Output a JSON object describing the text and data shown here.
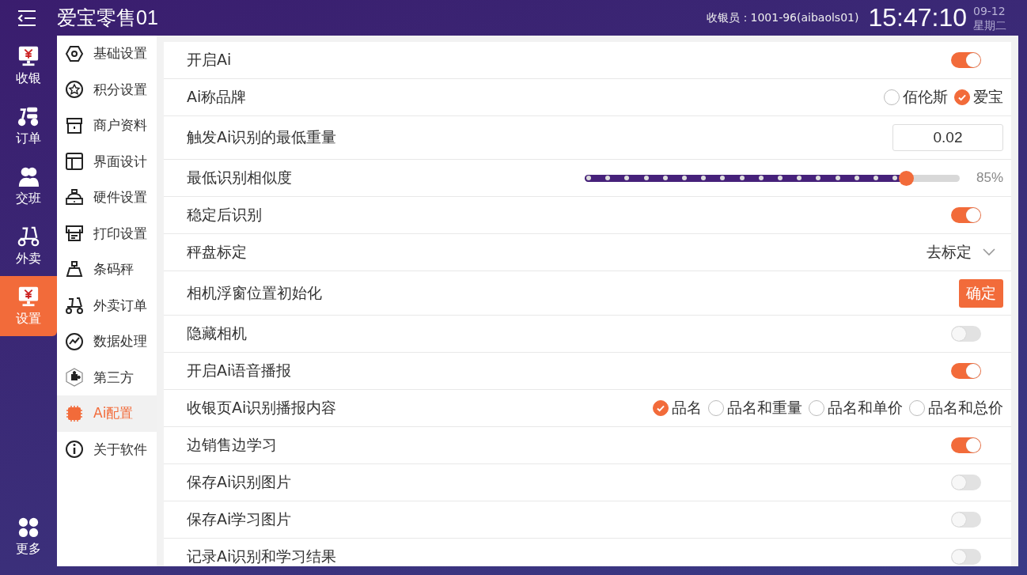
{
  "header": {
    "title": "爱宝零售01",
    "cashier": "收银员：1001-96(aibaols01)",
    "time": "15:47:10",
    "date": "09-12",
    "weekday": "星期二"
  },
  "nav": [
    {
      "label": "收银",
      "selected": false
    },
    {
      "label": "订单",
      "selected": false
    },
    {
      "label": "交班",
      "selected": false
    },
    {
      "label": "外卖",
      "selected": false
    },
    {
      "label": "设置",
      "selected": true
    },
    {
      "label": "更多",
      "selected": false
    }
  ],
  "submenu": [
    {
      "label": "基础设置",
      "selected": false
    },
    {
      "label": "积分设置",
      "selected": false
    },
    {
      "label": "商户资料",
      "selected": false
    },
    {
      "label": "界面设计",
      "selected": false
    },
    {
      "label": "硬件设置",
      "selected": false
    },
    {
      "label": "打印设置",
      "selected": false
    },
    {
      "label": "条码秤",
      "selected": false
    },
    {
      "label": "外卖订单",
      "selected": false
    },
    {
      "label": "数据处理",
      "selected": false
    },
    {
      "label": "第三方",
      "selected": false
    },
    {
      "label": "Ai配置",
      "selected": true
    },
    {
      "label": "关于软件",
      "selected": false
    }
  ],
  "settings": [
    {
      "kind": "toggle",
      "label": "开启Ai",
      "on": true
    },
    {
      "kind": "radio",
      "label": "Ai称品牌",
      "options": [
        {
          "label": "佰伦斯",
          "selected": false
        },
        {
          "label": "爱宝",
          "selected": true
        }
      ]
    },
    {
      "kind": "input",
      "label": "触发Ai识别的最低重量",
      "value": "0.02"
    },
    {
      "kind": "slider",
      "label": "最低识别相似度",
      "level": 0.85,
      "reading": "85%"
    },
    {
      "kind": "toggle",
      "label": "稳定后识别",
      "on": true
    },
    {
      "kind": "dropdown",
      "label": "秤盘标定",
      "value": "去标定"
    },
    {
      "kind": "button",
      "label": "相机浮窗位置初始化",
      "button": "确定"
    },
    {
      "kind": "toggle",
      "label": "隐藏相机",
      "on": false
    },
    {
      "kind": "toggle",
      "label": "开启Ai语音播报",
      "on": true
    },
    {
      "kind": "radio",
      "label": "收银页Ai识别播报内容",
      "options": [
        {
          "label": "品名",
          "selected": true
        },
        {
          "label": "品名和重量",
          "selected": false
        },
        {
          "label": "品名和单价",
          "selected": false
        },
        {
          "label": "品名和总价",
          "selected": false
        }
      ]
    },
    {
      "kind": "toggle",
      "label": "边销售边学习",
      "on": true
    },
    {
      "kind": "toggle",
      "label": "保存Ai识别图片",
      "on": false
    },
    {
      "kind": "toggle",
      "label": "保存Ai学习图片",
      "on": false
    },
    {
      "kind": "toggle",
      "label": "记录Ai识别和学习结果",
      "on": false
    }
  ]
}
